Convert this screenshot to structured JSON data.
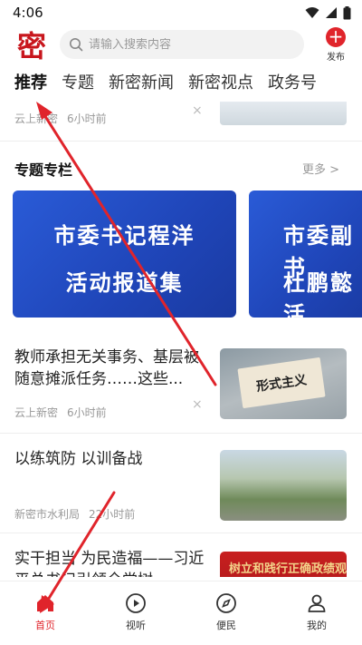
{
  "status_bar": {
    "time": "4:06"
  },
  "header": {
    "logo_text": "密",
    "search_placeholder": "请输入搜索内容",
    "publish_label": "发布"
  },
  "tabs": [
    {
      "label": "推荐",
      "active": true
    },
    {
      "label": "专题",
      "active": false
    },
    {
      "label": "新密新闻",
      "active": false
    },
    {
      "label": "新密视点",
      "active": false
    },
    {
      "label": "政务号",
      "active": false
    }
  ],
  "partial_item": {
    "source": "云上新密",
    "time": "6小时前",
    "close": "×"
  },
  "section": {
    "title": "专题专栏",
    "more": "更多 >"
  },
  "banners": [
    {
      "line1": "市委书记程洋",
      "line2": "活动报道集"
    },
    {
      "line1": "市委副书",
      "line2": "杜鹏懿活"
    }
  ],
  "news": [
    {
      "title": "教师承担无关事务、基层被随意摊派任务……这些...",
      "source": "云上新密",
      "time": "6小时前",
      "thumb_text": "形式主义",
      "close": "×"
    },
    {
      "title": "以练筑防  以训备战",
      "source": "新密市水利局",
      "time": "22小时前",
      "close": ""
    },
    {
      "title": "实干担当 为民造福——习近平总书记引领全党树...",
      "thumb_text": "树立和践行正确政绩观",
      "close": ""
    }
  ],
  "bottom_nav": [
    {
      "label": "首页",
      "icon": "home-icon",
      "active": true
    },
    {
      "label": "视听",
      "icon": "play-icon",
      "active": false
    },
    {
      "label": "便民",
      "icon": "compass-icon",
      "active": false
    },
    {
      "label": "我的",
      "icon": "user-icon",
      "active": false
    }
  ],
  "colors": {
    "brand_red": "#e0242b",
    "banner_blue": "#2a5bd7"
  }
}
